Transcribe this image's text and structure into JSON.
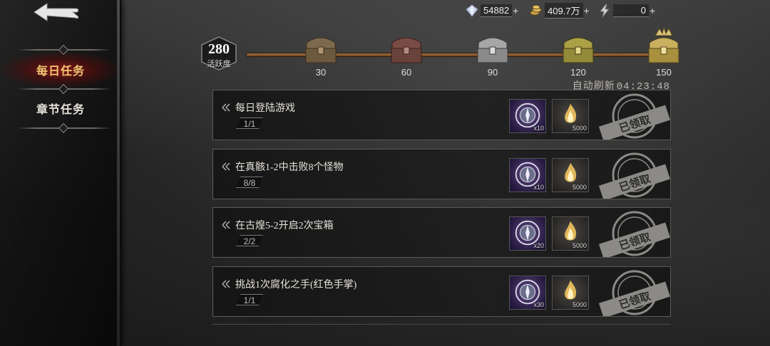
{
  "sidebar": {
    "tabs": [
      {
        "label": "每日任务",
        "active": true
      },
      {
        "label": "章节任务",
        "active": false
      }
    ]
  },
  "resources": [
    {
      "icon": "crystal-icon",
      "value": "54882",
      "plus": "+"
    },
    {
      "icon": "gold-coin-icon",
      "value": "409.7万",
      "plus": "+"
    },
    {
      "icon": "energy-icon",
      "value": "0",
      "plus": "+"
    }
  ],
  "activity": {
    "score": "280",
    "label": "活跃度",
    "milestones": [
      "30",
      "60",
      "90",
      "120",
      "150"
    ],
    "refresh_label": "自动刷新",
    "refresh_time": "04:23:48"
  },
  "tasks": [
    {
      "desc": "每日登陆游戏",
      "progress": "1/1",
      "reward1_amt": "x10",
      "reward2_amt": "5000",
      "status": "已领取"
    },
    {
      "desc": "在真骸1-2中击败8个怪物",
      "progress": "8/8",
      "reward1_amt": "x10",
      "reward2_amt": "5000",
      "status": "已领取"
    },
    {
      "desc": "在古煌5-2开启2次宝箱",
      "progress": "2/2",
      "reward1_amt": "x20",
      "reward2_amt": "5000",
      "status": "已领取"
    },
    {
      "desc": "挑战1次腐化之手(红色手掌)",
      "progress": "1/1",
      "reward1_amt": "x30",
      "reward2_amt": "5000",
      "status": "已领取"
    }
  ],
  "colors": {
    "active_tab": "#f0c873",
    "track": "#a2703f",
    "stamp": "#8c8a86"
  }
}
